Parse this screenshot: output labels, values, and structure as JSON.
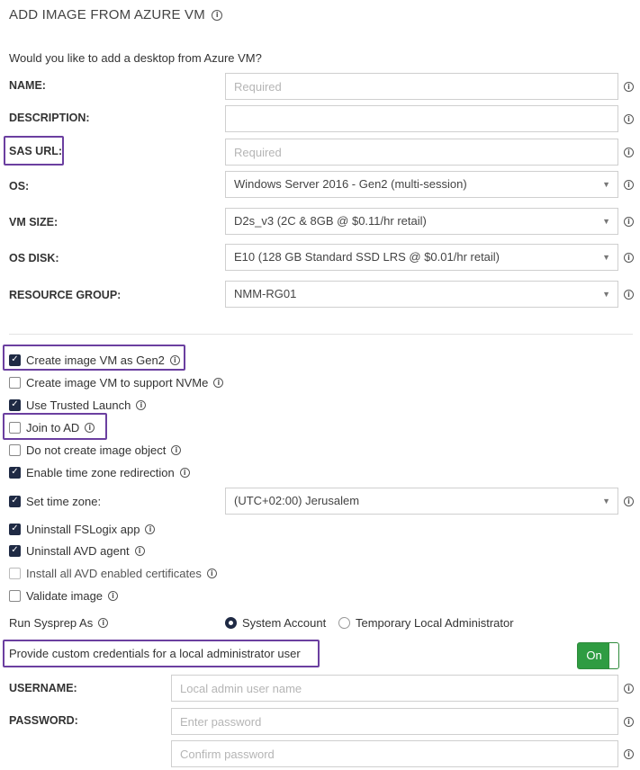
{
  "header": {
    "title": "ADD IMAGE FROM AZURE VM",
    "subtitle": "Would you like to add a desktop from Azure VM?"
  },
  "form": {
    "name": {
      "label": "NAME:",
      "value": "",
      "placeholder": "Required"
    },
    "description": {
      "label": "DESCRIPTION:",
      "value": "",
      "placeholder": ""
    },
    "sas_url": {
      "label": "SAS URL:",
      "value": "",
      "placeholder": "Required"
    },
    "os": {
      "label": "OS:",
      "value": "Windows Server 2016 - Gen2 (multi-session)"
    },
    "vm_size": {
      "label": "VM SIZE:",
      "value": "D2s_v3 (2C & 8GB @ $0.11/hr retail)"
    },
    "os_disk": {
      "label": "OS DISK:",
      "value": "E10 (128 GB Standard SSD LRS @ $0.01/hr retail)"
    },
    "resource_group": {
      "label": "RESOURCE GROUP:",
      "value": "NMM-RG01"
    }
  },
  "options": [
    {
      "label": "Create image VM as Gen2",
      "checked": true
    },
    {
      "label": "Create image VM to support NVMe",
      "checked": false
    },
    {
      "label": "Use Trusted Launch",
      "checked": true
    },
    {
      "label": "Join to AD",
      "checked": false
    },
    {
      "label": "Do not create image object",
      "checked": false
    },
    {
      "label": "Enable time zone redirection",
      "checked": true
    },
    {
      "label": "Set time zone:",
      "checked": true
    },
    {
      "label": "Uninstall FSLogix app",
      "checked": true
    },
    {
      "label": "Uninstall AVD agent",
      "checked": true
    },
    {
      "label": "Install all AVD enabled certificates",
      "checked": false
    },
    {
      "label": "Validate image",
      "checked": false
    }
  ],
  "timezone": {
    "value": "(UTC+02:00) Jerusalem"
  },
  "sysprep": {
    "label": "Run Sysprep As",
    "options": [
      {
        "label": "System Account",
        "selected": true
      },
      {
        "label": "Temporary Local Administrator",
        "selected": false
      }
    ]
  },
  "custom_credentials": {
    "label": "Provide custom credentials for a local administrator user",
    "toggle_label": "On",
    "enabled": true
  },
  "credentials": {
    "username": {
      "label": "USERNAME:",
      "value": "",
      "placeholder": "Local admin user name"
    },
    "password": {
      "label": "PASSWORD:",
      "value": "",
      "placeholder": "Enter password"
    },
    "confirm": {
      "value": "",
      "placeholder": "Confirm password"
    }
  },
  "icons": {
    "info": "ⓘ",
    "caret": "▼",
    "highlight_color": "#6b3fa0",
    "toggle_color": "#2f9c42",
    "check_color": "#1f2a44"
  }
}
